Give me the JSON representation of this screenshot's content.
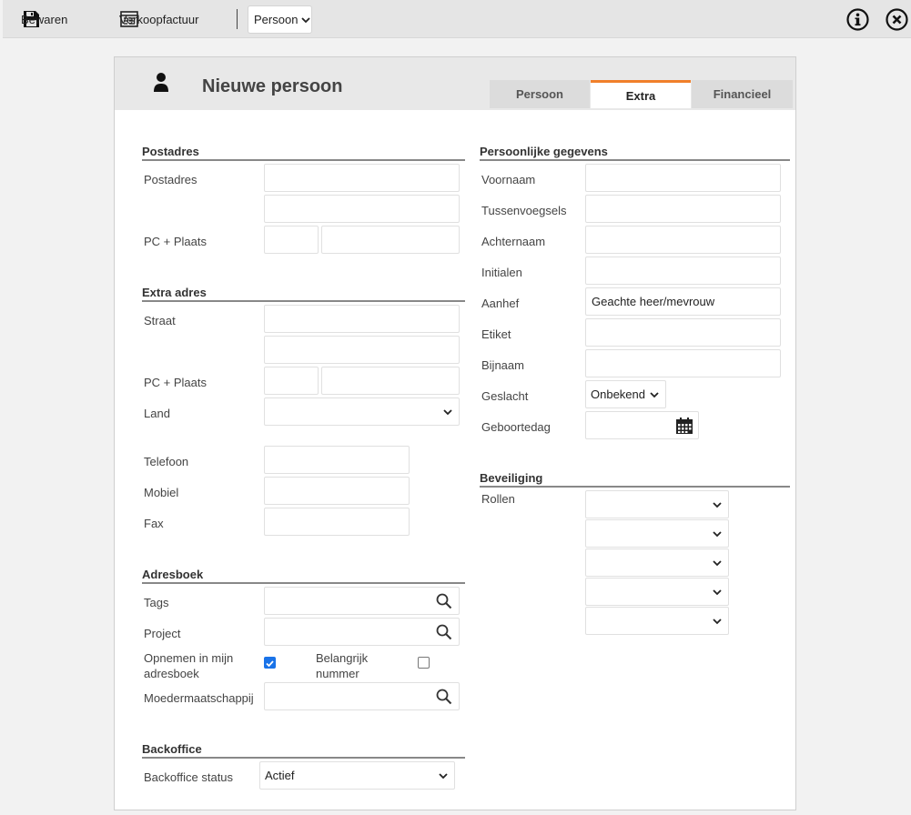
{
  "toolbar": {
    "save_label": "Bewaren",
    "invoice_label": "Verkoopfactuur",
    "type_select": "Persoon"
  },
  "dialog": {
    "title": "Nieuwe persoon",
    "tabs": [
      "Persoon",
      "Extra",
      "Financieel"
    ],
    "active_tab": "Extra"
  },
  "left": {
    "postadres": {
      "title": "Postadres",
      "postadres_label": "Postadres",
      "pc_label": "PC + Plaats"
    },
    "extra_adres": {
      "title": "Extra adres",
      "straat_label": "Straat",
      "pc_label": "PC + Plaats",
      "land_label": "Land",
      "land_value": ""
    },
    "contact": {
      "telefoon_label": "Telefoon",
      "mobiel_label": "Mobiel",
      "fax_label": "Fax"
    },
    "adresboek": {
      "title": "Adresboek",
      "tags_label": "Tags",
      "project_label": "Project",
      "opnemen_label_1": "Opnemen in mijn",
      "opnemen_label_2": "adresboek",
      "opnemen_checked": true,
      "belangrijk_label_1": "Belangrijk",
      "belangrijk_label_2": "nummer",
      "belangrijk_checked": false,
      "moeder_label": "Moedermaatschappij"
    },
    "backoffice": {
      "title": "Backoffice",
      "status_label": "Backoffice status",
      "status_value": "Actief"
    }
  },
  "right": {
    "persoonlijk": {
      "title": "Persoonlijke gegevens",
      "voornaam_label": "Voornaam",
      "tussenvoegsels_label": "Tussenvoegsels",
      "achternaam_label": "Achternaam",
      "initialen_label": "Initialen",
      "aanhef_label": "Aanhef",
      "aanhef_value": "Geachte heer/mevrouw",
      "etiket_label": "Etiket",
      "bijnaam_label": "Bijnaam",
      "geslacht_label": "Geslacht",
      "geslacht_value": "Onbekend",
      "geboortedag_label": "Geboortedag"
    },
    "beveiliging": {
      "title": "Beveiliging",
      "rollen_label": "Rollen",
      "rollen_values": [
        "",
        "",
        "",
        "",
        ""
      ]
    }
  },
  "colors": {
    "accent_tab": "#f07f2a",
    "checkbox_on": "#1a73e8"
  },
  "icons": [
    "save-icon",
    "invoice-icon",
    "chevron-down-icon",
    "info-icon",
    "close-icon",
    "person-icon",
    "search-icon",
    "calendar-icon"
  ]
}
